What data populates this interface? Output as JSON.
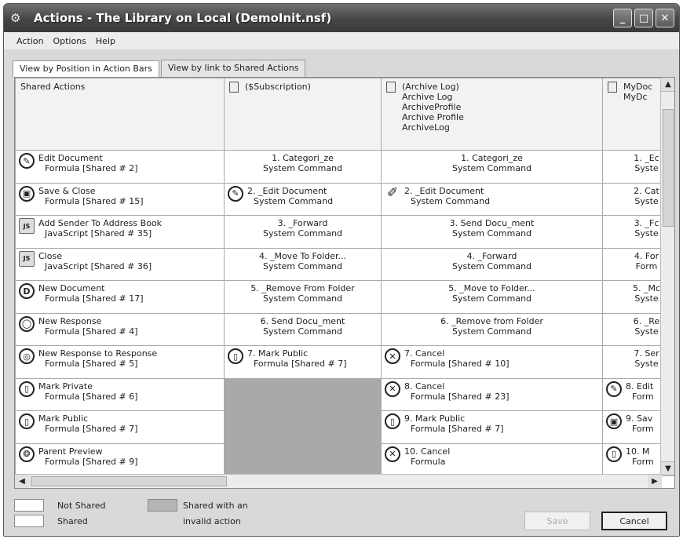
{
  "window": {
    "title": "Actions - The Library on Local (DemoInit.nsf)",
    "min": "_",
    "max": "□",
    "close": "✕"
  },
  "menu": [
    "Action",
    "Options",
    "Help"
  ],
  "tabs": [
    "View by Position in Action Bars",
    "View by link to Shared Actions"
  ],
  "columns": [
    {
      "lines": [
        "Shared Actions"
      ]
    },
    {
      "lines": [
        "($Subscription)"
      ]
    },
    {
      "lines": [
        "(Archive Log)",
        "Archive Log",
        "ArchiveProfile",
        "Archive Profile",
        "ArchiveLog"
      ]
    },
    {
      "lines": [
        "MyDoc",
        "MyDc"
      ]
    }
  ],
  "rows": [
    [
      {
        "icon": "✎",
        "t1": "Edit Document",
        "t2": "Formula [Shared # 2]"
      },
      {
        "t1": "1. Categori_ze",
        "t2": "System Command"
      },
      {
        "t1": "1. Categori_ze",
        "t2": "System Command"
      },
      {
        "t1": "1. _Ec",
        "t2": "Syste"
      }
    ],
    [
      {
        "icon": "▣",
        "t1": "Save & Close",
        "t2": "Formula [Shared # 15]"
      },
      {
        "icon": "✎",
        "t1": "2. _Edit Document",
        "t2": "System Command"
      },
      {
        "icon": "✐",
        "pen": true,
        "t1": "2. _Edit Document",
        "t2": "System Command"
      },
      {
        "t1": "2. Cat",
        "t2": "Syste"
      }
    ],
    [
      {
        "icon": "JS",
        "sq": true,
        "t1": "Add Sender To Address Book",
        "t2": "JavaScript [Shared # 35]"
      },
      {
        "t1": "3. _Forward",
        "t2": "System Command"
      },
      {
        "t1": "3. Send Docu_ment",
        "t2": "System Command"
      },
      {
        "t1": "3. _Fc",
        "t2": "Syste"
      }
    ],
    [
      {
        "icon": "JS",
        "sq": true,
        "t1": "Close",
        "t2": "JavaScript [Shared # 36]"
      },
      {
        "t1": "4. _Move To Folder...",
        "t2": "System Command"
      },
      {
        "t1": "4. _Forward",
        "t2": "System Command"
      },
      {
        "t1": "4. For",
        "t2": "Form"
      }
    ],
    [
      {
        "icon": "D",
        "t1": "New Document",
        "t2": "Formula [Shared # 17]"
      },
      {
        "t1": "5. _Remove From Folder",
        "t2": "System Command"
      },
      {
        "t1": "5. _Move to Folder...",
        "t2": "System Command"
      },
      {
        "t1": "5. _Mc",
        "t2": "Syste"
      }
    ],
    [
      {
        "icon": "◯",
        "t1": "New Response",
        "t2": "Formula [Shared # 4]"
      },
      {
        "t1": "6. Send Docu_ment",
        "t2": "System Command"
      },
      {
        "t1": "6. _Remove from Folder",
        "t2": "System Command"
      },
      {
        "t1": "6. _Re",
        "t2": "Syste"
      }
    ],
    [
      {
        "icon": "◎",
        "t1": "New Response to Response",
        "t2": "Formula [Shared # 5]"
      },
      {
        "icon": "▯",
        "t1": "7. Mark Public",
        "t2": "Formula [Shared # 7]"
      },
      {
        "icon": "✕",
        "t1": "7. Cancel",
        "t2": "Formula [Shared # 10]"
      },
      {
        "t1": "7. Ser",
        "t2": "Syste"
      }
    ],
    [
      {
        "icon": "▯",
        "t1": "Mark Private",
        "t2": "Formula [Shared # 6]"
      },
      {
        "invalid": true
      },
      {
        "icon": "✕",
        "t1": "8. Cancel",
        "t2": "Formula [Shared # 23]"
      },
      {
        "icon": "✎",
        "t1": "8. Edit",
        "t2": "Form"
      }
    ],
    [
      {
        "icon": "▯",
        "t1": "Mark Public",
        "t2": "Formula [Shared # 7]"
      },
      {
        "invalid": true
      },
      {
        "icon": "▯",
        "t1": "9. Mark Public",
        "t2": "Formula [Shared # 7]"
      },
      {
        "icon": "▣",
        "t1": "9. Sav",
        "t2": "Form"
      }
    ],
    [
      {
        "icon": "❂",
        "t1": "Parent Preview",
        "t2": "Formula [Shared # 9]"
      },
      {
        "invalid": true
      },
      {
        "icon": "✕",
        "t1": "10. Cancel",
        "t2": "Formula"
      },
      {
        "icon": "▯",
        "t1": "10. M",
        "t2": "Form"
      }
    ]
  ],
  "legend": {
    "not_shared": "Not Shared",
    "shared": "Shared",
    "invalid_1": "Shared with an",
    "invalid_2": "invalid action"
  },
  "buttons": {
    "save": "Save",
    "cancel": "Cancel"
  }
}
